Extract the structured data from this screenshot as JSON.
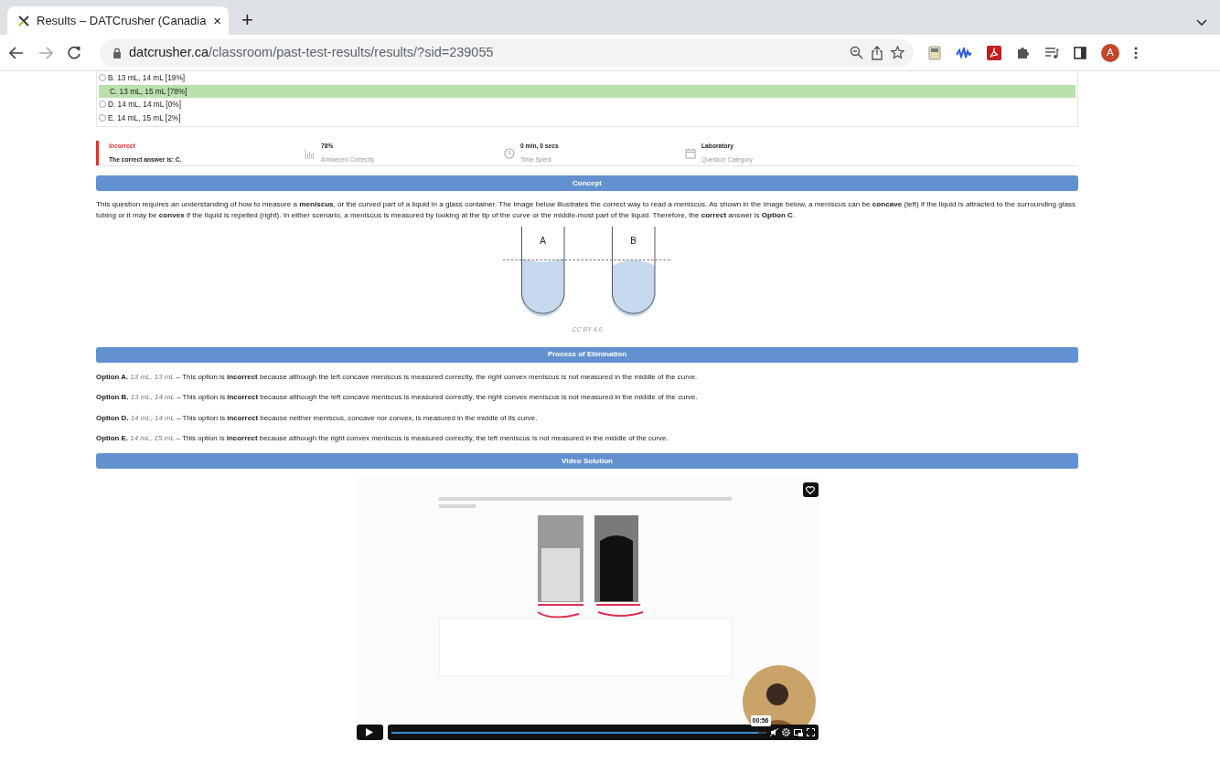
{
  "browser": {
    "tab_title": "Results – DATCrusher (Canadia",
    "tab_close": "×",
    "new_tab": "+",
    "url_domain": "datcrusher.ca",
    "url_path": "/classroom/past-test-results/results/?sid=239055",
    "profile_initial": "A"
  },
  "choices": [
    {
      "label": "B. 13 mL, 14 mL [19%]",
      "selected": false
    },
    {
      "label": "C. 13 mL, 15 mL [78%]",
      "selected": true
    },
    {
      "label": "D. 14 mL, 14 mL [0%]",
      "selected": false
    },
    {
      "label": "E. 14 mL, 15 mL [2%]",
      "selected": false
    }
  ],
  "result": {
    "status": "Incorrect",
    "detail": "The correct answer is: C."
  },
  "stats": [
    {
      "kind": "chart",
      "value": "78%",
      "caption": "Answered Correctly"
    },
    {
      "kind": "clock",
      "value": "0 min, 0 secs",
      "caption": "Time Spent"
    },
    {
      "kind": "calendar",
      "value": "Laboratory",
      "caption": "Question Category"
    }
  ],
  "concept": {
    "heading": "Concept",
    "paragraph": "This question requires an understanding of how to measure a **meniscus**, or the curved part of a liquid in a glass container. The image below illustrates the correct way to read a meniscus. As shown in the image below, a meniscus can be **concave** (left) if the liquid is attracted to the surrounding glass tubing or it may be **convex** if the liquid is repelled (right). In either scenario, a meniscus is measured by looking at the tip of the curve or the middle-most part of the liquid. Therefore, the **correct** answer is **Option C**.",
    "figure": {
      "labels": [
        "A",
        "B"
      ],
      "credit": "CC BY 4.0"
    }
  },
  "elimination": {
    "heading": "Process of Elimination",
    "items": [
      {
        "option": "Option A.",
        "values": "13 mL, 13 mL",
        "text": "– This option is **incorrect** because although the left concave meniscus is measured correctly, the right convex meniscus is not measured in the middle of the curve."
      },
      {
        "option": "Option B.",
        "values": "13 mL, 14 mL",
        "text": "– This option is **incorrect** because although the left concave meniscus is measured correctly, the right convex meniscus is not measured in the middle of the curve."
      },
      {
        "option": "Option D.",
        "values": "14 mL, 14 mL",
        "text": "– This option is **incorrect** because neither meniscus, concave nor convex, is measured in the middle of its curve."
      },
      {
        "option": "Option E.",
        "values": "14 mL, 15 mL",
        "text": "– This option is **incorrect** because although the right convex meniscus is measured correctly, the left meniscus is not measured in the middle of the curve."
      }
    ]
  },
  "video": {
    "heading": "Video Solution",
    "time": "00:56",
    "level": 0.98
  }
}
